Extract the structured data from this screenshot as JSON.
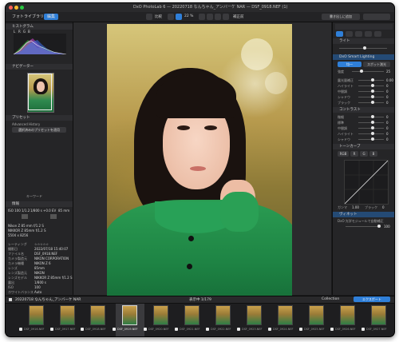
{
  "window": {
    "title": "DxO PhotoLab 6 — 20220718 なんちゃん_アンバーケ NAR — DSF_0918.NEF (1)",
    "traffic_lights": {
      "close": "#ff5f57",
      "minimize": "#febc2e",
      "zoom": "#28c840"
    }
  },
  "toolbar": {
    "tab_library": "フォトライブラリ",
    "tab_edit": "編集",
    "compare_label": "比較",
    "zoom_label": "22 %",
    "before_label": "補正前",
    "export_label": "書き出しに追加",
    "accent": "#2f7fd8"
  },
  "left_panel": {
    "histogram_title": "ヒストグラム",
    "histogram_channels": [
      "L",
      "R",
      "G",
      "B"
    ],
    "navigator_title": "ナビゲーター",
    "presets_title": "プリセット",
    "advanced_history_title": "Advanced History",
    "apply_preset_btn": "選択済みのプリセットを適用",
    "keywords_title": "キーワード",
    "info_title": "情報",
    "exif_row": [
      "ISO 100",
      "1/1.2",
      "1/800 s",
      "+0.0 EV",
      "85 mm"
    ],
    "lens_name": "Nikon Z 85 mm f/1.2 S",
    "lens_model": "NIKKOR Z 85mm f/1.2 S",
    "dims": "5504 x 8256",
    "metadata": [
      {
        "label": "レーティング",
        "value": "☆☆☆☆☆"
      },
      {
        "label": "撮影日",
        "value": "2022/07/18 15:40:07"
      },
      {
        "label": "ファイル名",
        "value": "DSF_0918.NEF"
      },
      {
        "label": "カメラ製造元",
        "value": "NIKON CORPORATION"
      },
      {
        "label": "カメラ機種",
        "value": "NIKON Z 6"
      },
      {
        "label": "レンズ",
        "value": "85mm"
      },
      {
        "label": "レンズ製造元",
        "value": "NIKON"
      },
      {
        "label": "レンズモデル",
        "value": "NIKKOR Z 85mm f/1.2 S"
      },
      {
        "label": "露出",
        "value": "1/800 s"
      },
      {
        "label": "ISO",
        "value": "100"
      },
      {
        "label": "ホワイトバランス",
        "value": "Auto"
      },
      {
        "label": "キーワード",
        "value": ""
      }
    ]
  },
  "right_panel": {
    "tabs": [
      "ライト",
      "カラー",
      "ディテール",
      "ジオメトリ",
      "ローカル"
    ],
    "light_section": "ライト",
    "smart_lighting_title": "DxO Smart Lighting",
    "smart_lighting_modes": [
      "均一",
      "スポット測光"
    ],
    "intensity_label": "強度",
    "intensity_value": "25",
    "tone_rows": [
      {
        "label": "露光量補正",
        "value": "0.00"
      },
      {
        "label": "ハイライト",
        "value": "0"
      },
      {
        "label": "中間調",
        "value": "0"
      },
      {
        "label": "シャドウ",
        "value": "0"
      },
      {
        "label": "ブラック",
        "value": "0"
      }
    ],
    "contrast_title": "コントラスト",
    "contrast_rows": [
      {
        "label": "微細",
        "value": "0"
      },
      {
        "label": "標準",
        "value": "0"
      },
      {
        "label": "中間調",
        "value": "0"
      },
      {
        "label": "ハイライト",
        "value": "0"
      },
      {
        "label": "シャドウ",
        "value": "0"
      }
    ],
    "tone_curve_title": "トーンカーブ",
    "curve_channels": [
      "RGB",
      "R",
      "G",
      "B"
    ],
    "curve_controls": [
      "ガンマ",
      "1.00",
      "ブラック",
      "0"
    ],
    "vignetting_title": "ヴィネット",
    "vignetting_source": "DxO 光学モジュールで自動補正",
    "vignetting_intensity": "100"
  },
  "filmstrip": {
    "folder_path": "20220718 なんちゃん_アンバーケ NAR",
    "count_label": "表示中 1/179",
    "collection_label": "Collection",
    "export_button": "エクスポート",
    "thumbnails": [
      {
        "caption": "DSF_0916.NEF",
        "selected": false
      },
      {
        "caption": "DSF_0917.NEF",
        "selected": false
      },
      {
        "caption": "DSF_0918.NEF",
        "selected": false
      },
      {
        "caption": "DSF_0919.NEF",
        "selected": true
      },
      {
        "caption": "DSF_0920.NEF",
        "selected": false
      },
      {
        "caption": "DSF_0921.NEF",
        "selected": false
      },
      {
        "caption": "DSF_0922.NEF",
        "selected": false
      },
      {
        "caption": "DSF_0923.NEF",
        "selected": false
      },
      {
        "caption": "DSF_0924.NEF",
        "selected": false
      },
      {
        "caption": "DSF_0925.NEF",
        "selected": false
      },
      {
        "caption": "DSF_0926.NEF",
        "selected": false
      },
      {
        "caption": "DSF_0927.NEF",
        "selected": false
      }
    ]
  }
}
